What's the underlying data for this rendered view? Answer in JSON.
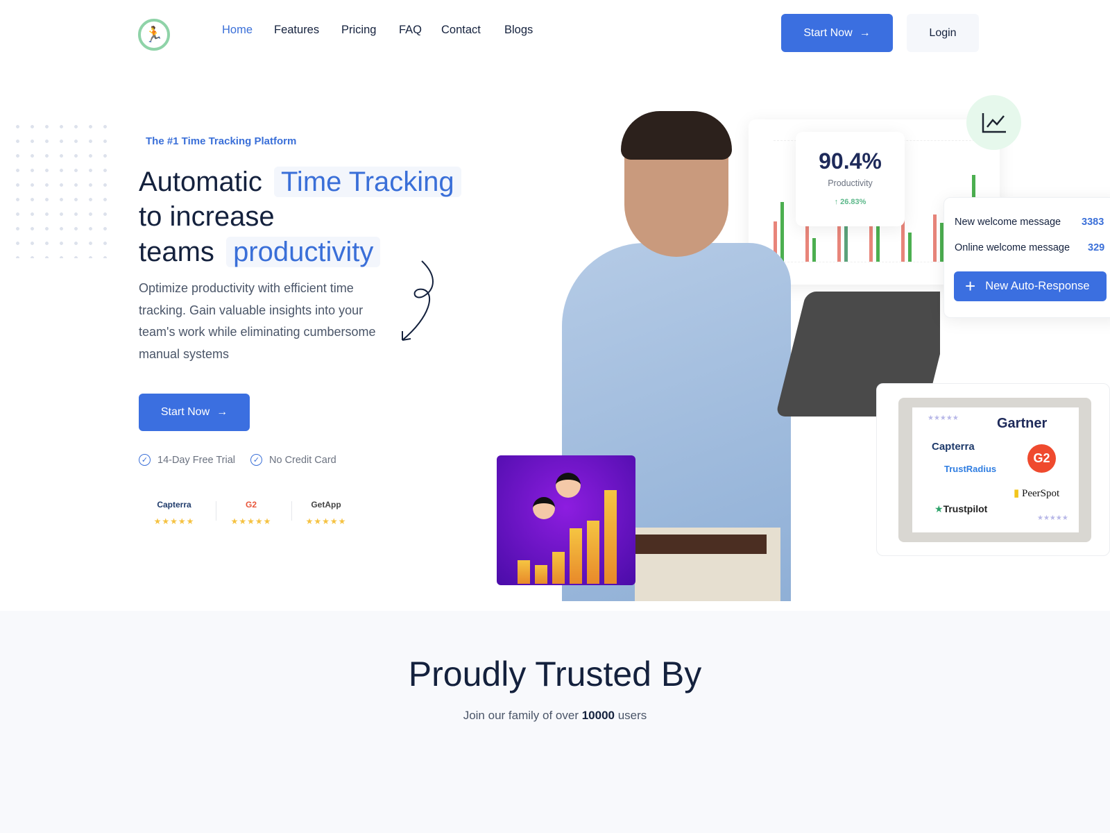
{
  "nav": {
    "logo_icon": "stopwatch-runner-icon",
    "items": [
      {
        "label": "Home",
        "active": true
      },
      {
        "label": "Features"
      },
      {
        "label": "Pricing"
      },
      {
        "label": "FAQ"
      },
      {
        "label": "Contact"
      },
      {
        "label": "Blogs"
      }
    ],
    "start_now": "Start Now",
    "login": "Login"
  },
  "hero": {
    "tagline": "The #1 Time Tracking Platform",
    "line1": "Automatic",
    "line1_highlight": "Time Tracking",
    "line2": "to increase",
    "line3": "teams",
    "line3_highlight": "productivity",
    "description": "Optimize productivity with efficient time tracking. Gain valuable insights into your team's work while eliminating cumbersome manual systems",
    "cta": "Start Now",
    "checks": [
      "14-Day Free Trial",
      "No Credit Card"
    ],
    "ratings": [
      {
        "name": "Capterra",
        "stars": "★★★★★"
      },
      {
        "name": "G2",
        "stars": "★★★★★"
      },
      {
        "name": "GetApp",
        "stars": "★★★★★"
      }
    ]
  },
  "stats": {
    "value": "90.4%",
    "label": "Productivity",
    "change": "26.83%",
    "icon": "line-chart-icon"
  },
  "messages": {
    "rows": [
      {
        "label": "New welcome message",
        "count": "3383"
      },
      {
        "label": "Online welcome message",
        "count": "329"
      }
    ],
    "button": "New Auto-Response"
  },
  "reviews": {
    "logos": [
      "Gartner",
      "Capterra",
      "TrustRadius",
      "G2",
      "PeerSpot",
      "Trustpilot"
    ],
    "stars_a": "★★★★★",
    "stars_b": "★★★★★"
  },
  "trusted": {
    "title": "Proudly Trusted By",
    "subtitle_pre": "Join our family of over ",
    "count": "10000",
    "subtitle_post": " users"
  },
  "colors": {
    "accent": "#3b6fe0",
    "green": "#4caf50",
    "red": "#e8857a"
  }
}
